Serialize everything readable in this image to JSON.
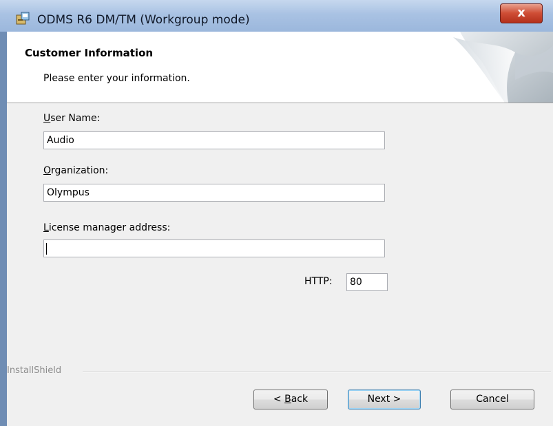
{
  "window": {
    "title": "ODMS R6 DM/TM (Workgroup mode)",
    "close_label": "x"
  },
  "banner": {
    "title": "Customer Information",
    "subtitle": "Please enter your information."
  },
  "form": {
    "user_name": {
      "label_accel": "U",
      "label_rest": "ser Name:",
      "value": "Audio"
    },
    "organization": {
      "label_accel": "O",
      "label_rest": "rganization:",
      "value": "Olympus"
    },
    "license_manager": {
      "label_accel": "L",
      "label_rest": "icense manager address:",
      "value": ""
    },
    "http": {
      "label": "HTTP:",
      "value": "80"
    }
  },
  "footer": {
    "group_label": "InstallShield",
    "back": {
      "prefix": "< ",
      "accel": "B",
      "rest": "ack"
    },
    "next_label": "Next >",
    "cancel_label": "Cancel"
  }
}
